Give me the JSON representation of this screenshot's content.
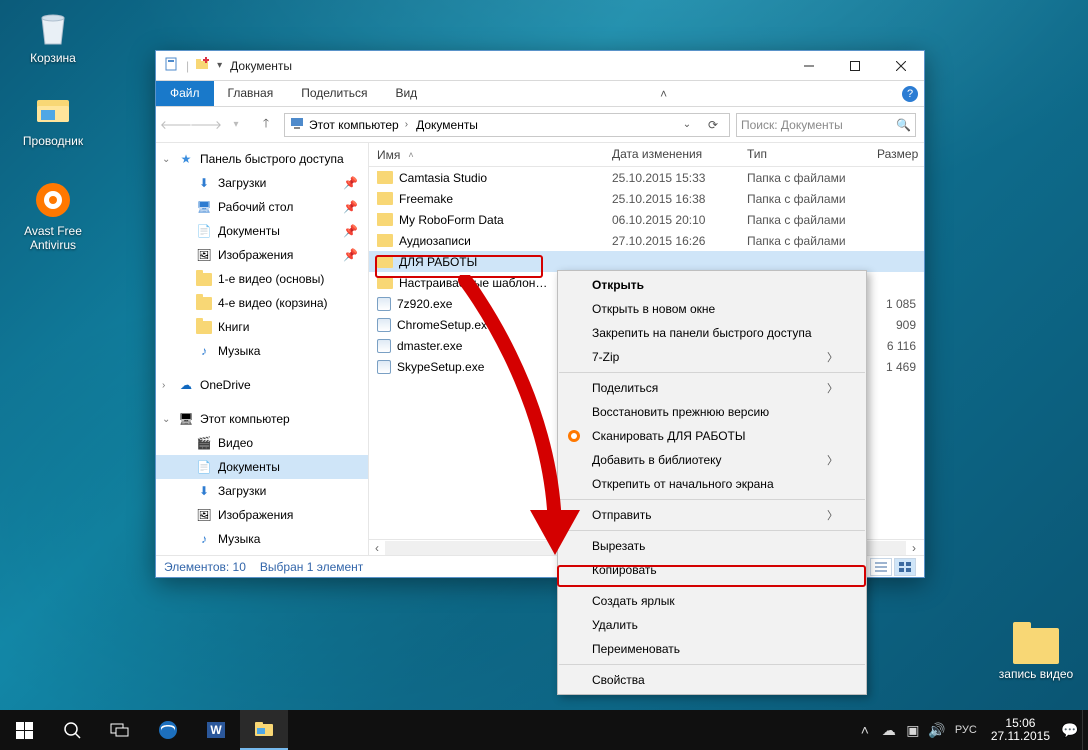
{
  "desktop": {
    "icons": {
      "recycle": "Корзина",
      "explorer": "Проводник",
      "avast": "Avast Free Antivirus",
      "record_folder": "запись видео"
    }
  },
  "taskbar": {
    "lang": "РУС",
    "time": "15:06",
    "date": "27.11.2015"
  },
  "window": {
    "title": "Документы",
    "tabs": {
      "file": "Файл",
      "home": "Главная",
      "share": "Поделиться",
      "view": "Вид"
    },
    "breadcrumb": {
      "pc": "Этот компьютер",
      "docs": "Документы"
    },
    "search_placeholder": "Поиск: Документы",
    "columns": {
      "name": "Имя",
      "date": "Дата изменения",
      "type": "Тип",
      "size": "Размер"
    },
    "status": {
      "count": "Элементов: 10",
      "selected": "Выбран 1 элемент"
    },
    "items": [
      {
        "name": "Camtasia Studio",
        "date": "25.10.2015 15:33",
        "type": "Папка с файлами",
        "size": "",
        "icon": "folder"
      },
      {
        "name": "Freemake",
        "date": "25.10.2015 16:38",
        "type": "Папка с файлами",
        "size": "",
        "icon": "folder"
      },
      {
        "name": "My RoboForm Data",
        "date": "06.10.2015 20:10",
        "type": "Папка с файлами",
        "size": "",
        "icon": "folder"
      },
      {
        "name": "Аудиозаписи",
        "date": "27.10.2015 16:26",
        "type": "Папка с файлами",
        "size": "",
        "icon": "folder"
      },
      {
        "name": "ДЛЯ РАБОТЫ",
        "date": "",
        "type": "",
        "size": "",
        "icon": "folder",
        "selected": true
      },
      {
        "name": "Настраиваемые шаблон…",
        "date": "",
        "type": "",
        "size": "",
        "icon": "folder"
      },
      {
        "name": "7z920.exe",
        "date": "",
        "type": "",
        "size": "1 085",
        "icon": "exe"
      },
      {
        "name": "ChromeSetup.exe",
        "date": "",
        "type": "",
        "size": "909",
        "icon": "exe"
      },
      {
        "name": "dmaster.exe",
        "date": "",
        "type": "",
        "size": "6 116",
        "icon": "exe"
      },
      {
        "name": "SkypeSetup.exe",
        "date": "",
        "type": "",
        "size": "1 469",
        "icon": "exe"
      }
    ],
    "nav": {
      "quick": "Панель быстрого доступа",
      "downloads": "Загрузки",
      "desktop_f": "Рабочий стол",
      "documents": "Документы",
      "pictures": "Изображения",
      "video1": "1-е видео (основы)",
      "video4": "4-е видео (корзина)",
      "books": "Книги",
      "music": "Музыка",
      "onedrive": "OneDrive",
      "thispc": "Этот компьютер",
      "video": "Видео",
      "documents2": "Документы",
      "downloads2": "Загрузки",
      "pictures2": "Изображения",
      "music2": "Музыка"
    }
  },
  "ctx": {
    "open": "Открыть",
    "open_new": "Открыть в новом окне",
    "pin_quick": "Закрепить на панели быстрого доступа",
    "sevenzip": "7-Zip",
    "share": "Поделиться",
    "restore": "Восстановить прежнюю версию",
    "scan": "Сканировать ДЛЯ РАБОТЫ",
    "add_lib": "Добавить в библиотеку",
    "unpin_start": "Открепить от начального экрана",
    "send_to": "Отправить",
    "cut": "Вырезать",
    "copy": "Копировать",
    "shortcut": "Создать ярлык",
    "delete": "Удалить",
    "rename": "Переименовать",
    "props": "Свойства"
  }
}
